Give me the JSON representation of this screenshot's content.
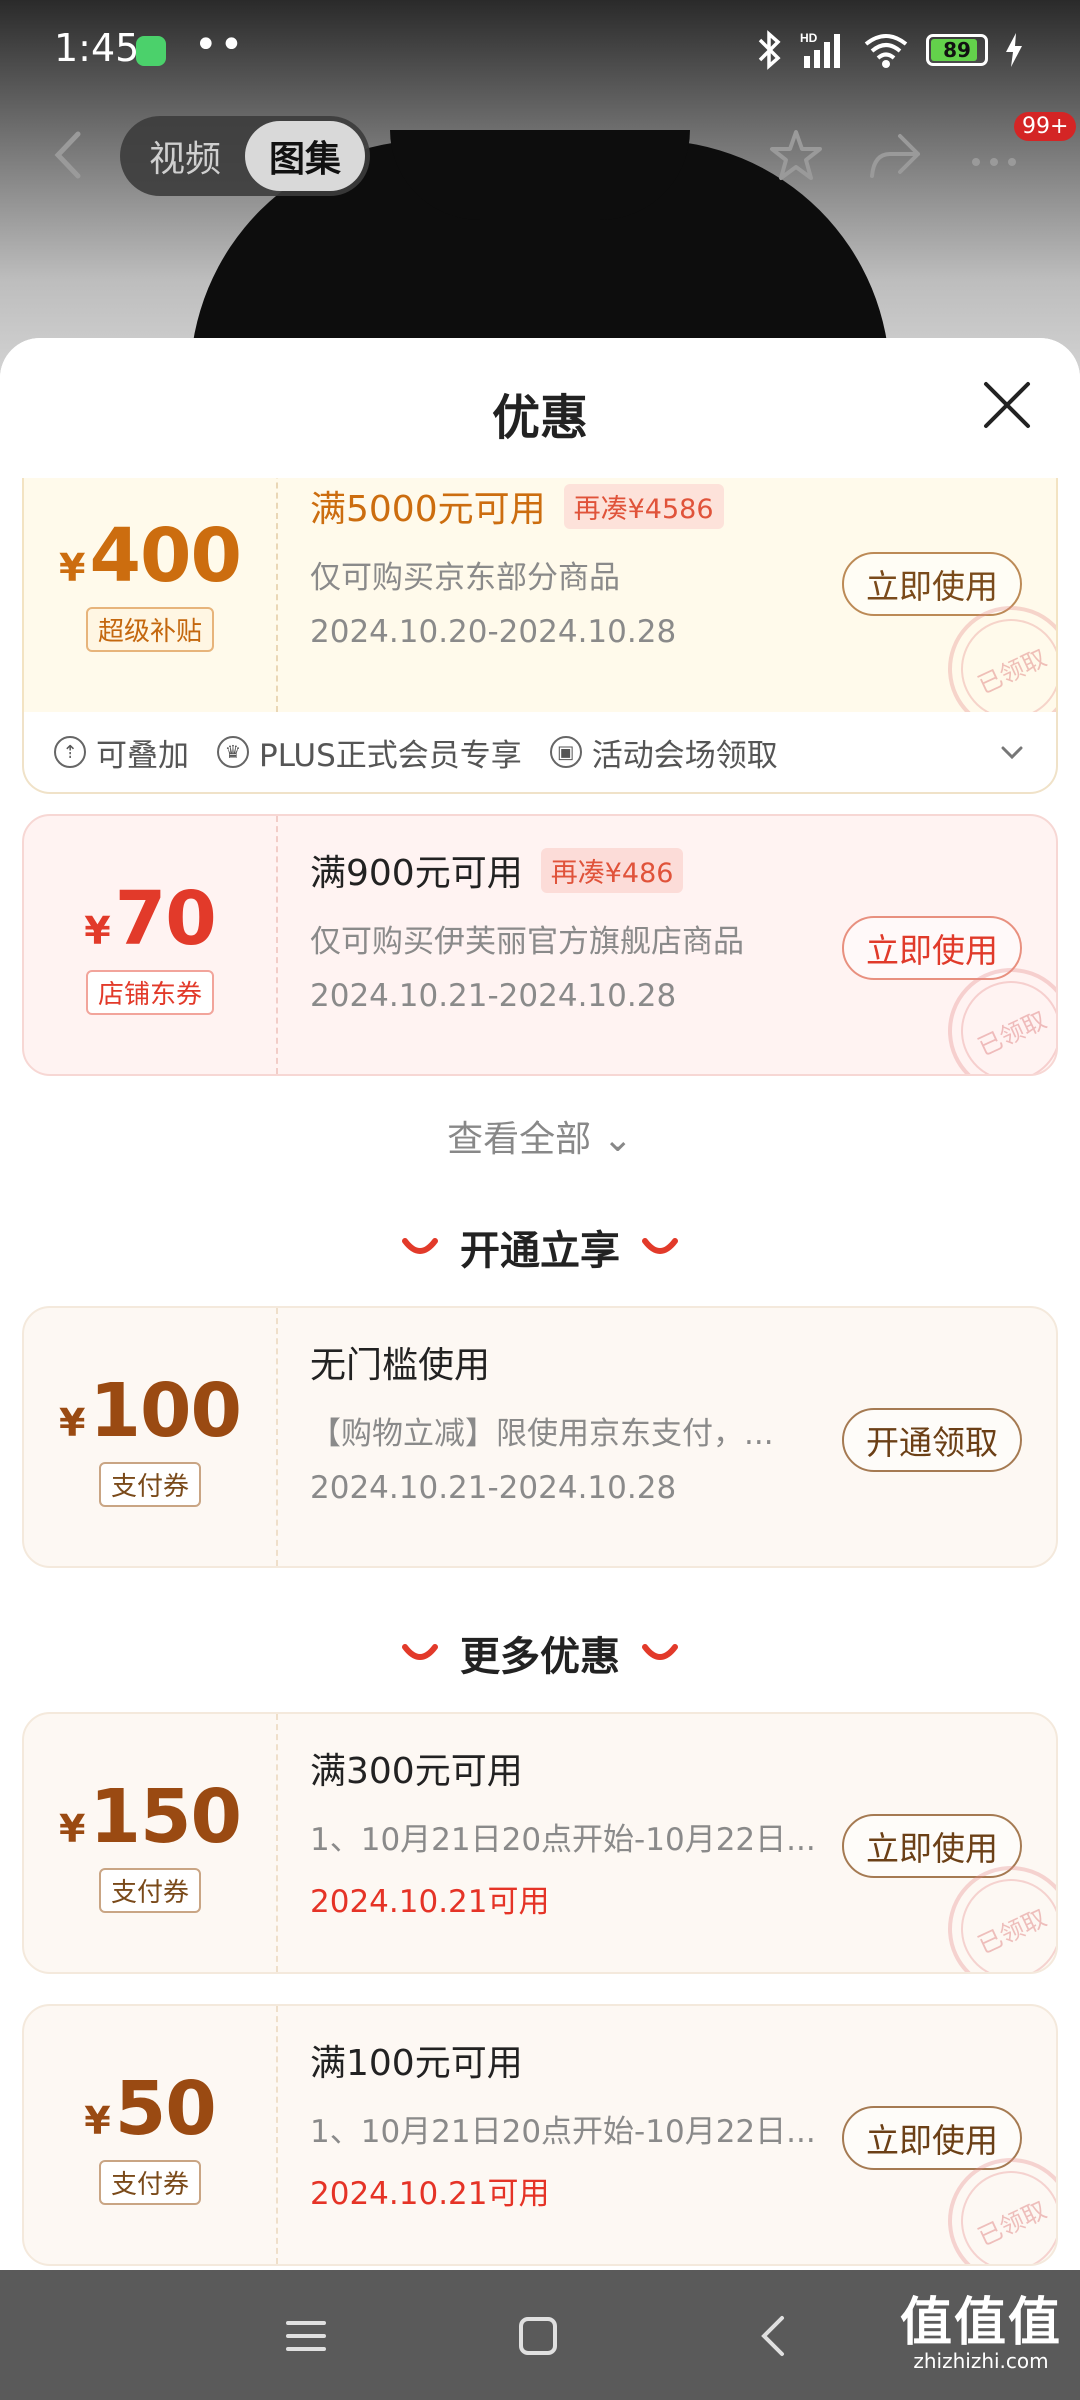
{
  "status_bar": {
    "time": "1:45",
    "dots": "••",
    "battery": "89",
    "battery_level": 0.89
  },
  "top_nav": {
    "tabs": [
      "视频",
      "图集"
    ],
    "active_tab": "图集",
    "badge": "99+"
  },
  "sheet": {
    "title": "优惠",
    "view_all": "查看全部",
    "coupons_main": [
      {
        "currency": "¥",
        "amount": "400",
        "type": "超级补贴",
        "condition": "满5000元可用",
        "tag": "再凑¥4586",
        "description": "仅可购买京东部分商品",
        "date": "2024.10.20-2024.10.28",
        "button": "立即使用",
        "stamp": "已领取"
      },
      {
        "currency": "¥",
        "amount": "70",
        "type": "店铺东券",
        "condition": "满900元可用",
        "tag": "再凑¥486",
        "description": "仅可购买伊芙丽官方旗舰店商品",
        "date": "2024.10.21-2024.10.28",
        "button": "立即使用",
        "stamp": "已领取"
      }
    ],
    "benefits": [
      "可叠加",
      "PLUS正式会员专享",
      "活动会场领取"
    ],
    "section_open": {
      "title": "开通立享",
      "coupon": {
        "currency": "¥",
        "amount": "100",
        "type": "支付券",
        "condition": "无门槛使用",
        "description": "【购物立减】限使用京东支付，...",
        "date": "2024.10.21-2024.10.28",
        "button": "开通领取"
      }
    },
    "section_more": {
      "title": "更多优惠",
      "coupons": [
        {
          "currency": "¥",
          "amount": "150",
          "type": "支付券",
          "condition": "满300元可用",
          "description": "1、10月21日20点开始-10月22日...",
          "date": "2024.10.21可用",
          "button": "立即使用",
          "stamp": "已领取"
        },
        {
          "currency": "¥",
          "amount": "50",
          "type": "支付券",
          "condition": "满100元可用",
          "description": "1、10月21日20点开始-10月22日...",
          "date": "2024.10.21可用",
          "button": "立即使用",
          "stamp": "已领取"
        }
      ]
    }
  },
  "watermark": {
    "main": "值值值",
    "sub": "zhizhizhi.com"
  },
  "colors": {
    "accent_red": "#e23a2a",
    "gold": "#cc6d0f",
    "brown": "#9a4a12"
  }
}
